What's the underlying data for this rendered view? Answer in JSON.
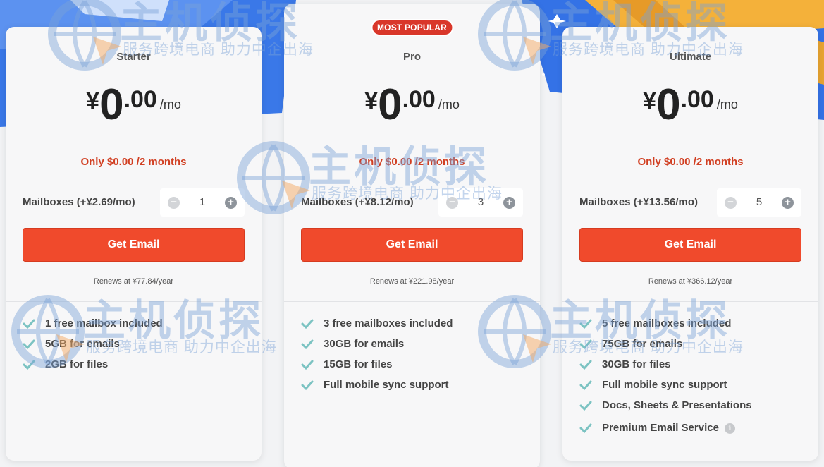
{
  "plans": {
    "starter": {
      "name": "Starter",
      "currency": "¥",
      "price_int": "0",
      "price_dec": ".00",
      "per": "/mo",
      "promo": "Only $0.00 /2 months",
      "mailbox_label": "Mailboxes (+¥2.69/mo)",
      "quantity": "1",
      "cta": "Get Email",
      "renews": "Renews at ¥77.84/year",
      "features": [
        "1 free mailbox included",
        "5GB for emails",
        "2GB for files"
      ]
    },
    "pro": {
      "badge": "MOST POPULAR",
      "name": "Pro",
      "currency": "¥",
      "price_int": "0",
      "price_dec": ".00",
      "per": "/mo",
      "promo": "Only $0.00 /2 months",
      "mailbox_label": "Mailboxes (+¥8.12/mo)",
      "quantity": "3",
      "cta": "Get Email",
      "renews": "Renews at ¥221.98/year",
      "features": [
        "3 free mailboxes included",
        "30GB for emails",
        "15GB for files",
        "Full mobile sync support"
      ]
    },
    "ultimate": {
      "name": "Ultimate",
      "currency": "¥",
      "price_int": "0",
      "price_dec": ".00",
      "per": "/mo",
      "promo": "Only $0.00 /2 months",
      "mailbox_label": "Mailboxes (+¥13.56/mo)",
      "quantity": "5",
      "cta": "Get Email",
      "renews": "Renews at ¥366.12/year",
      "features": [
        "5 free mailboxes included",
        "75GB for emails",
        "30GB for files",
        "Full mobile sync support",
        "Docs, Sheets & Presentations",
        "Premium Email Service"
      ]
    }
  },
  "stepper": {
    "minus": "−",
    "plus": "+"
  },
  "info_icon": "i",
  "watermark": {
    "brand": "主机侦探",
    "slogan": "服务跨境电商 助力中企出海"
  },
  "colors": {
    "cta": "#f04a2c",
    "promo": "#d13f22",
    "badge": "#d9372a",
    "check": "#7cc3c2",
    "card_bg": "#f7f7f8"
  }
}
